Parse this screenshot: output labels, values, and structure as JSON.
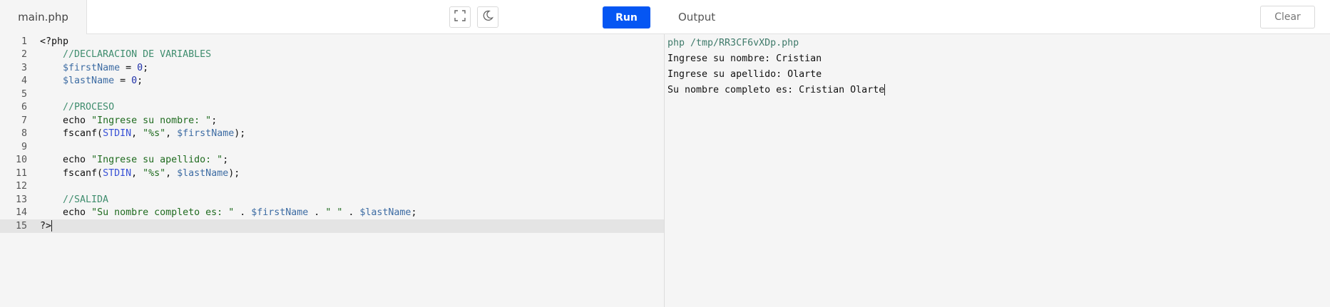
{
  "editor": {
    "file_tab": "main.php",
    "run_label": "Run",
    "lines": [
      {
        "n": "1",
        "tokens": [
          {
            "t": "<?php",
            "c": "plain"
          }
        ]
      },
      {
        "n": "2",
        "tokens": [
          {
            "t": "    //DECLARACION DE VARIABLES",
            "c": "cmt"
          }
        ]
      },
      {
        "n": "3",
        "tokens": [
          {
            "t": "    ",
            "c": "plain"
          },
          {
            "t": "$firstName",
            "c": "var"
          },
          {
            "t": " = ",
            "c": "plain"
          },
          {
            "t": "0",
            "c": "num"
          },
          {
            "t": ";",
            "c": "plain"
          }
        ]
      },
      {
        "n": "4",
        "tokens": [
          {
            "t": "    ",
            "c": "plain"
          },
          {
            "t": "$lastName",
            "c": "var"
          },
          {
            "t": " = ",
            "c": "plain"
          },
          {
            "t": "0",
            "c": "num"
          },
          {
            "t": ";",
            "c": "plain"
          }
        ]
      },
      {
        "n": "5",
        "tokens": []
      },
      {
        "n": "6",
        "tokens": [
          {
            "t": "    //PROCESO",
            "c": "cmt"
          }
        ]
      },
      {
        "n": "7",
        "tokens": [
          {
            "t": "    echo ",
            "c": "plain"
          },
          {
            "t": "\"Ingrese su nombre: \"",
            "c": "str"
          },
          {
            "t": ";",
            "c": "plain"
          }
        ]
      },
      {
        "n": "8",
        "tokens": [
          {
            "t": "    fscanf(",
            "c": "plain"
          },
          {
            "t": "STDIN",
            "c": "const"
          },
          {
            "t": ", ",
            "c": "plain"
          },
          {
            "t": "\"%s\"",
            "c": "str"
          },
          {
            "t": ", ",
            "c": "plain"
          },
          {
            "t": "$firstName",
            "c": "var"
          },
          {
            "t": ");",
            "c": "plain"
          }
        ]
      },
      {
        "n": "9",
        "tokens": []
      },
      {
        "n": "10",
        "tokens": [
          {
            "t": "    echo ",
            "c": "plain"
          },
          {
            "t": "\"Ingrese su apellido: \"",
            "c": "str"
          },
          {
            "t": ";",
            "c": "plain"
          }
        ]
      },
      {
        "n": "11",
        "tokens": [
          {
            "t": "    fscanf(",
            "c": "plain"
          },
          {
            "t": "STDIN",
            "c": "const"
          },
          {
            "t": ", ",
            "c": "plain"
          },
          {
            "t": "\"%s\"",
            "c": "str"
          },
          {
            "t": ", ",
            "c": "plain"
          },
          {
            "t": "$lastName",
            "c": "var"
          },
          {
            "t": ");",
            "c": "plain"
          }
        ]
      },
      {
        "n": "12",
        "tokens": []
      },
      {
        "n": "13",
        "tokens": [
          {
            "t": "    //SALIDA",
            "c": "cmt"
          }
        ]
      },
      {
        "n": "14",
        "tokens": [
          {
            "t": "    echo ",
            "c": "plain"
          },
          {
            "t": "\"Su nombre completo es: \"",
            "c": "str"
          },
          {
            "t": " . ",
            "c": "plain"
          },
          {
            "t": "$firstName",
            "c": "var"
          },
          {
            "t": " . ",
            "c": "plain"
          },
          {
            "t": "\" \"",
            "c": "str"
          },
          {
            "t": " . ",
            "c": "plain"
          },
          {
            "t": "$lastName",
            "c": "var"
          },
          {
            "t": ";",
            "c": "plain"
          }
        ]
      },
      {
        "n": "15",
        "tokens": [
          {
            "t": "?>",
            "c": "plain"
          }
        ],
        "active": true
      }
    ]
  },
  "output": {
    "title": "Output",
    "clear_label": "Clear",
    "lines": [
      "php /tmp/RR3CF6vXDp.php",
      "Ingrese su nombre: Cristian",
      "Ingrese su apellido: Olarte",
      "Su nombre completo es: Cristian Olarte"
    ]
  },
  "icons": {
    "fullscreen": "fullscreen-icon",
    "theme": "moon-icon"
  },
  "colors": {
    "run": "#0556f3",
    "comment": "#3f8d6e",
    "variable": "#3d6ca3",
    "string": "#1f6b1f"
  }
}
